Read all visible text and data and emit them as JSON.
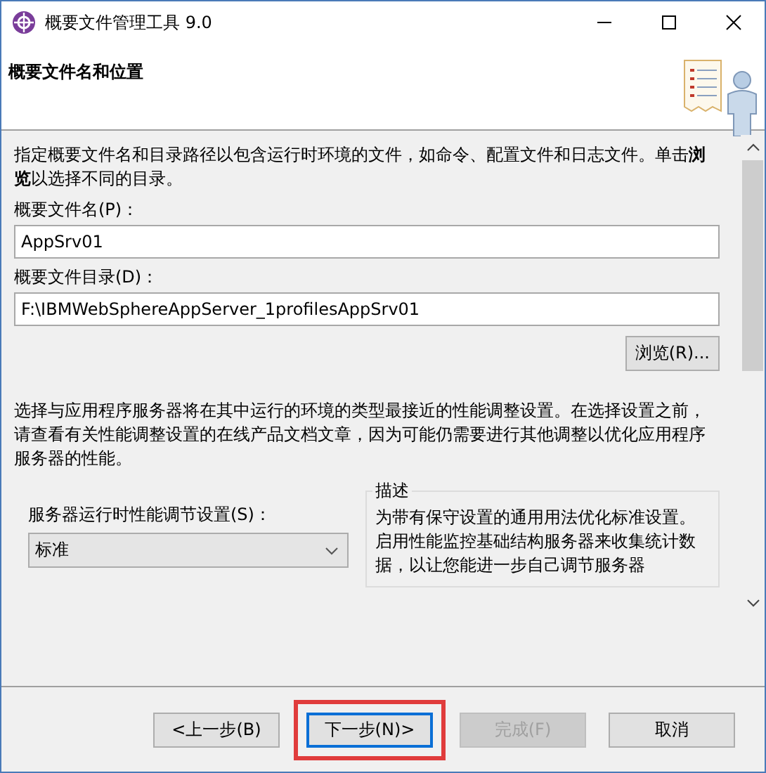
{
  "window": {
    "title": "概要文件管理工具 9.0"
  },
  "header": {
    "title": "概要文件名和位置"
  },
  "intro": "指定概要文件名和目录路径以包含运行时环境的文件，如命令、配置文件和日志文件。单击**浏览**以选择不同的目录。",
  "profile_name": {
    "label": "概要文件名(P)：",
    "value": "AppSrv01"
  },
  "profile_dir": {
    "label": "概要文件目录(D)：",
    "value": "F:\\IBMWebSphereAppServer_1profilesAppSrv01"
  },
  "browse_button": "浏览(R)...",
  "tuning_text": "选择与应用程序服务器将在其中运行的环境的类型最接近的性能调整设置。在选择设置之前，请查看有关性能调整设置的在线产品文档文章，因为可能仍需要进行其他调整以优化应用程序服务器的性能。",
  "tuning": {
    "label": "服务器运行时性能调节设置(S)：",
    "value": "标准"
  },
  "description": {
    "legend": "描述",
    "lines": [
      "为带有保守设置的通用用法优化标准设置。",
      "启用性能监控基础结构服务器来收集统计数",
      "据，以让您能进一步自己调节服务器"
    ]
  },
  "buttons": [
    {
      "label": "<上一步(B)",
      "disabled": false,
      "focused": false,
      "highlighted": false
    },
    {
      "label": "下一步(N)>",
      "disabled": false,
      "focused": true,
      "highlighted": true
    },
    {
      "label": "完成(F)",
      "disabled": true,
      "focused": false,
      "highlighted": false
    },
    {
      "label": "取消",
      "disabled": false,
      "focused": false,
      "highlighted": false
    }
  ]
}
